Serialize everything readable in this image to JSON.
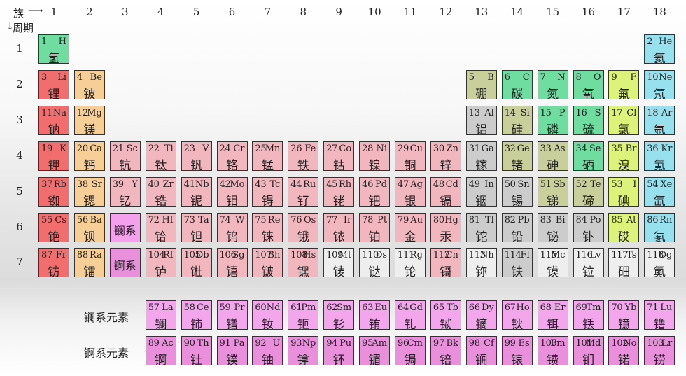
{
  "header": {
    "group_label": "族",
    "period_label": "周期"
  },
  "groups": [
    "1",
    "2",
    "3",
    "4",
    "5",
    "6",
    "7",
    "8",
    "9",
    "10",
    "11",
    "12",
    "13",
    "14",
    "15",
    "16",
    "17",
    "18"
  ],
  "periods": [
    "1",
    "2",
    "3",
    "4",
    "5",
    "6",
    "7"
  ],
  "series_labels": {
    "lanthanide": "镧系元素",
    "actinide": "锕系元素"
  },
  "colors": {
    "alkali": "#f26d6d",
    "alkaline": "#f7cf96",
    "transition": "#f2b6be",
    "post_transition": "#cccccc",
    "metalloid": "#c9cf9a",
    "nonmetal": "#6fdca0",
    "halogen": "#dcf27a",
    "noble": "#97e1ef",
    "lanthanide": "#f3a6ec",
    "actinide": "#ea8fdc",
    "series_marker": "#f5a0ec",
    "unknown": "#eeeeee"
  },
  "elements": [
    {
      "num": "1",
      "sym": "H",
      "cn": "氢",
      "g": 1,
      "p": 1,
      "cat": "nonmetal"
    },
    {
      "num": "2",
      "sym": "He",
      "cn": "氦",
      "g": 18,
      "p": 1,
      "cat": "noble"
    },
    {
      "num": "3",
      "sym": "Li",
      "cn": "锂",
      "g": 1,
      "p": 2,
      "cat": "alkali"
    },
    {
      "num": "4",
      "sym": "Be",
      "cn": "铍",
      "g": 2,
      "p": 2,
      "cat": "alkaline"
    },
    {
      "num": "5",
      "sym": "B",
      "cn": "硼",
      "g": 13,
      "p": 2,
      "cat": "metalloid"
    },
    {
      "num": "6",
      "sym": "C",
      "cn": "碳",
      "g": 14,
      "p": 2,
      "cat": "nonmetal"
    },
    {
      "num": "7",
      "sym": "N",
      "cn": "氮",
      "g": 15,
      "p": 2,
      "cat": "nonmetal"
    },
    {
      "num": "8",
      "sym": "O",
      "cn": "氧",
      "g": 16,
      "p": 2,
      "cat": "nonmetal"
    },
    {
      "num": "9",
      "sym": "F",
      "cn": "氟",
      "g": 17,
      "p": 2,
      "cat": "halogen"
    },
    {
      "num": "10",
      "sym": "Ne",
      "cn": "氖",
      "g": 18,
      "p": 2,
      "cat": "noble"
    },
    {
      "num": "11",
      "sym": "Na",
      "cn": "钠",
      "g": 1,
      "p": 3,
      "cat": "alkali"
    },
    {
      "num": "12",
      "sym": "Mg",
      "cn": "镁",
      "g": 2,
      "p": 3,
      "cat": "alkaline"
    },
    {
      "num": "13",
      "sym": "Al",
      "cn": "铝",
      "g": 13,
      "p": 3,
      "cat": "post_transition"
    },
    {
      "num": "14",
      "sym": "Si",
      "cn": "硅",
      "g": 14,
      "p": 3,
      "cat": "metalloid"
    },
    {
      "num": "15",
      "sym": "P",
      "cn": "磷",
      "g": 15,
      "p": 3,
      "cat": "nonmetal"
    },
    {
      "num": "16",
      "sym": "S",
      "cn": "硫",
      "g": 16,
      "p": 3,
      "cat": "nonmetal"
    },
    {
      "num": "17",
      "sym": "Cl",
      "cn": "氯",
      "g": 17,
      "p": 3,
      "cat": "halogen"
    },
    {
      "num": "18",
      "sym": "Ar",
      "cn": "氩",
      "g": 18,
      "p": 3,
      "cat": "noble"
    },
    {
      "num": "19",
      "sym": "K",
      "cn": "钾",
      "g": 1,
      "p": 4,
      "cat": "alkali"
    },
    {
      "num": "20",
      "sym": "Ca",
      "cn": "钙",
      "g": 2,
      "p": 4,
      "cat": "alkaline"
    },
    {
      "num": "21",
      "sym": "Sc",
      "cn": "钪",
      "g": 3,
      "p": 4,
      "cat": "transition"
    },
    {
      "num": "22",
      "sym": "Ti",
      "cn": "钛",
      "g": 4,
      "p": 4,
      "cat": "transition"
    },
    {
      "num": "23",
      "sym": "V",
      "cn": "钒",
      "g": 5,
      "p": 4,
      "cat": "transition"
    },
    {
      "num": "24",
      "sym": "Cr",
      "cn": "铬",
      "g": 6,
      "p": 4,
      "cat": "transition"
    },
    {
      "num": "25",
      "sym": "Mn",
      "cn": "锰",
      "g": 7,
      "p": 4,
      "cat": "transition"
    },
    {
      "num": "26",
      "sym": "Fe",
      "cn": "铁",
      "g": 8,
      "p": 4,
      "cat": "transition"
    },
    {
      "num": "27",
      "sym": "Co",
      "cn": "钴",
      "g": 9,
      "p": 4,
      "cat": "transition"
    },
    {
      "num": "28",
      "sym": "Ni",
      "cn": "镍",
      "g": 10,
      "p": 4,
      "cat": "transition"
    },
    {
      "num": "29",
      "sym": "Cu",
      "cn": "铜",
      "g": 11,
      "p": 4,
      "cat": "transition"
    },
    {
      "num": "30",
      "sym": "Zn",
      "cn": "锌",
      "g": 12,
      "p": 4,
      "cat": "transition"
    },
    {
      "num": "31",
      "sym": "Ga",
      "cn": "镓",
      "g": 13,
      "p": 4,
      "cat": "post_transition"
    },
    {
      "num": "32",
      "sym": "Ge",
      "cn": "锗",
      "g": 14,
      "p": 4,
      "cat": "metalloid"
    },
    {
      "num": "33",
      "sym": "As",
      "cn": "砷",
      "g": 15,
      "p": 4,
      "cat": "metalloid"
    },
    {
      "num": "34",
      "sym": "Se",
      "cn": "硒",
      "g": 16,
      "p": 4,
      "cat": "nonmetal"
    },
    {
      "num": "35",
      "sym": "Br",
      "cn": "溴",
      "g": 17,
      "p": 4,
      "cat": "halogen"
    },
    {
      "num": "36",
      "sym": "Kr",
      "cn": "氪",
      "g": 18,
      "p": 4,
      "cat": "noble"
    },
    {
      "num": "37",
      "sym": "Rb",
      "cn": "铷",
      "g": 1,
      "p": 5,
      "cat": "alkali"
    },
    {
      "num": "38",
      "sym": "Sr",
      "cn": "锶",
      "g": 2,
      "p": 5,
      "cat": "alkaline"
    },
    {
      "num": "39",
      "sym": "Y",
      "cn": "钇",
      "g": 3,
      "p": 5,
      "cat": "transition"
    },
    {
      "num": "40",
      "sym": "Zr",
      "cn": "锆",
      "g": 4,
      "p": 5,
      "cat": "transition"
    },
    {
      "num": "41",
      "sym": "Nb",
      "cn": "铌",
      "g": 5,
      "p": 5,
      "cat": "transition"
    },
    {
      "num": "42",
      "sym": "Mo",
      "cn": "钼",
      "g": 6,
      "p": 5,
      "cat": "transition"
    },
    {
      "num": "43",
      "sym": "Tc",
      "cn": "锝",
      "g": 7,
      "p": 5,
      "cat": "transition"
    },
    {
      "num": "44",
      "sym": "Ru",
      "cn": "钌",
      "g": 8,
      "p": 5,
      "cat": "transition"
    },
    {
      "num": "45",
      "sym": "Rh",
      "cn": "铑",
      "g": 9,
      "p": 5,
      "cat": "transition"
    },
    {
      "num": "46",
      "sym": "Pd",
      "cn": "钯",
      "g": 10,
      "p": 5,
      "cat": "transition"
    },
    {
      "num": "47",
      "sym": "Ag",
      "cn": "银",
      "g": 11,
      "p": 5,
      "cat": "transition"
    },
    {
      "num": "48",
      "sym": "Cd",
      "cn": "镉",
      "g": 12,
      "p": 5,
      "cat": "transition"
    },
    {
      "num": "49",
      "sym": "In",
      "cn": "铟",
      "g": 13,
      "p": 5,
      "cat": "post_transition"
    },
    {
      "num": "50",
      "sym": "Sn",
      "cn": "锡",
      "g": 14,
      "p": 5,
      "cat": "post_transition"
    },
    {
      "num": "51",
      "sym": "Sb",
      "cn": "锑",
      "g": 15,
      "p": 5,
      "cat": "metalloid"
    },
    {
      "num": "52",
      "sym": "Te",
      "cn": "碲",
      "g": 16,
      "p": 5,
      "cat": "metalloid"
    },
    {
      "num": "53",
      "sym": "I",
      "cn": "碘",
      "g": 17,
      "p": 5,
      "cat": "halogen"
    },
    {
      "num": "54",
      "sym": "Xe",
      "cn": "氙",
      "g": 18,
      "p": 5,
      "cat": "noble"
    },
    {
      "num": "55",
      "sym": "Cs",
      "cn": "铯",
      "g": 1,
      "p": 6,
      "cat": "alkali"
    },
    {
      "num": "56",
      "sym": "Ba",
      "cn": "钡",
      "g": 2,
      "p": 6,
      "cat": "alkaline"
    },
    {
      "num": "",
      "sym": "",
      "cn": "镧系",
      "g": 3,
      "p": 6,
      "cat": "series_marker",
      "series": true
    },
    {
      "num": "72",
      "sym": "Hf",
      "cn": "铪",
      "g": 4,
      "p": 6,
      "cat": "transition"
    },
    {
      "num": "73",
      "sym": "Ta",
      "cn": "钽",
      "g": 5,
      "p": 6,
      "cat": "transition"
    },
    {
      "num": "74",
      "sym": "W",
      "cn": "钨",
      "g": 6,
      "p": 6,
      "cat": "transition"
    },
    {
      "num": "75",
      "sym": "Re",
      "cn": "铼",
      "g": 7,
      "p": 6,
      "cat": "transition"
    },
    {
      "num": "76",
      "sym": "Os",
      "cn": "锇",
      "g": 8,
      "p": 6,
      "cat": "transition"
    },
    {
      "num": "77",
      "sym": "Ir",
      "cn": "铱",
      "g": 9,
      "p": 6,
      "cat": "transition"
    },
    {
      "num": "78",
      "sym": "Pt",
      "cn": "铂",
      "g": 10,
      "p": 6,
      "cat": "transition"
    },
    {
      "num": "79",
      "sym": "Au",
      "cn": "金",
      "g": 11,
      "p": 6,
      "cat": "transition"
    },
    {
      "num": "80",
      "sym": "Hg",
      "cn": "汞",
      "g": 12,
      "p": 6,
      "cat": "transition"
    },
    {
      "num": "81",
      "sym": "Tl",
      "cn": "铊",
      "g": 13,
      "p": 6,
      "cat": "post_transition"
    },
    {
      "num": "82",
      "sym": "Pb",
      "cn": "铅",
      "g": 14,
      "p": 6,
      "cat": "post_transition"
    },
    {
      "num": "83",
      "sym": "Bi",
      "cn": "铋",
      "g": 15,
      "p": 6,
      "cat": "post_transition"
    },
    {
      "num": "84",
      "sym": "Po",
      "cn": "钋",
      "g": 16,
      "p": 6,
      "cat": "post_transition"
    },
    {
      "num": "85",
      "sym": "At",
      "cn": "砹",
      "g": 17,
      "p": 6,
      "cat": "halogen"
    },
    {
      "num": "86",
      "sym": "Rn",
      "cn": "氡",
      "g": 18,
      "p": 6,
      "cat": "noble"
    },
    {
      "num": "87",
      "sym": "Fr",
      "cn": "钫",
      "g": 1,
      "p": 7,
      "cat": "alkali"
    },
    {
      "num": "88",
      "sym": "Ra",
      "cn": "镭",
      "g": 2,
      "p": 7,
      "cat": "alkaline"
    },
    {
      "num": "",
      "sym": "",
      "cn": "锕系",
      "g": 3,
      "p": 7,
      "cat": "actinide",
      "series": true
    },
    {
      "num": "104",
      "sym": "Rf",
      "cn": "𬬻",
      "g": 4,
      "p": 7,
      "cat": "transition"
    },
    {
      "num": "105",
      "sym": "Db",
      "cn": "𬭊",
      "g": 5,
      "p": 7,
      "cat": "transition"
    },
    {
      "num": "106",
      "sym": "Sg",
      "cn": "𬭳",
      "g": 6,
      "p": 7,
      "cat": "transition"
    },
    {
      "num": "107",
      "sym": "Bh",
      "cn": "𬭛",
      "g": 7,
      "p": 7,
      "cat": "transition"
    },
    {
      "num": "108",
      "sym": "Hs",
      "cn": "𬭶",
      "g": 8,
      "p": 7,
      "cat": "transition"
    },
    {
      "num": "109",
      "sym": "Mt",
      "cn": "鿏",
      "g": 9,
      "p": 7,
      "cat": "unknown"
    },
    {
      "num": "110",
      "sym": "Ds",
      "cn": "𫟼",
      "g": 10,
      "p": 7,
      "cat": "unknown"
    },
    {
      "num": "111",
      "sym": "Rg",
      "cn": "𬬭",
      "g": 11,
      "p": 7,
      "cat": "unknown"
    },
    {
      "num": "112",
      "sym": "Cn",
      "cn": "鿔",
      "g": 12,
      "p": 7,
      "cat": "transition"
    },
    {
      "num": "113",
      "sym": "Nh",
      "cn": "鿭",
      "g": 13,
      "p": 7,
      "cat": "unknown"
    },
    {
      "num": "114",
      "sym": "Fl",
      "cn": "𫓧",
      "g": 14,
      "p": 7,
      "cat": "post_transition"
    },
    {
      "num": "115",
      "sym": "Mc",
      "cn": "镆",
      "g": 15,
      "p": 7,
      "cat": "unknown"
    },
    {
      "num": "116",
      "sym": "Lv",
      "cn": "𫟷",
      "g": 16,
      "p": 7,
      "cat": "unknown"
    },
    {
      "num": "117",
      "sym": "Ts",
      "cn": "鿬",
      "g": 17,
      "p": 7,
      "cat": "unknown"
    },
    {
      "num": "118",
      "sym": "Og",
      "cn": "鿫",
      "g": 18,
      "p": 7,
      "cat": "unknown"
    }
  ],
  "lanthanides": [
    {
      "num": "57",
      "sym": "La",
      "cn": "镧"
    },
    {
      "num": "58",
      "sym": "Ce",
      "cn": "铈"
    },
    {
      "num": "59",
      "sym": "Pr",
      "cn": "镨"
    },
    {
      "num": "60",
      "sym": "Nd",
      "cn": "钕"
    },
    {
      "num": "61",
      "sym": "Pm",
      "cn": "钷"
    },
    {
      "num": "62",
      "sym": "Sm",
      "cn": "钐"
    },
    {
      "num": "63",
      "sym": "Eu",
      "cn": "铕"
    },
    {
      "num": "64",
      "sym": "Gd",
      "cn": "钆"
    },
    {
      "num": "65",
      "sym": "Tb",
      "cn": "铽"
    },
    {
      "num": "66",
      "sym": "Dy",
      "cn": "镝"
    },
    {
      "num": "67",
      "sym": "Ho",
      "cn": "钬"
    },
    {
      "num": "68",
      "sym": "Er",
      "cn": "铒"
    },
    {
      "num": "69",
      "sym": "Tm",
      "cn": "铥"
    },
    {
      "num": "70",
      "sym": "Yb",
      "cn": "镱"
    },
    {
      "num": "71",
      "sym": "Lu",
      "cn": "镥"
    }
  ],
  "actinides": [
    {
      "num": "89",
      "sym": "Ac",
      "cn": "锕"
    },
    {
      "num": "90",
      "sym": "Th",
      "cn": "钍"
    },
    {
      "num": "91",
      "sym": "Pa",
      "cn": "镤"
    },
    {
      "num": "92",
      "sym": "U",
      "cn": "铀"
    },
    {
      "num": "93",
      "sym": "Np",
      "cn": "镎"
    },
    {
      "num": "94",
      "sym": "Pu",
      "cn": "钚"
    },
    {
      "num": "95",
      "sym": "Am",
      "cn": "镅"
    },
    {
      "num": "96",
      "sym": "Cm",
      "cn": "锔"
    },
    {
      "num": "97",
      "sym": "Bk",
      "cn": "锫"
    },
    {
      "num": "98",
      "sym": "Cf",
      "cn": "锎"
    },
    {
      "num": "99",
      "sym": "Es",
      "cn": "锿"
    },
    {
      "num": "100",
      "sym": "Fm",
      "cn": "镄"
    },
    {
      "num": "101",
      "sym": "Md",
      "cn": "钔"
    },
    {
      "num": "102",
      "sym": "No",
      "cn": "锘"
    },
    {
      "num": "103",
      "sym": "Lr",
      "cn": "铹"
    }
  ]
}
